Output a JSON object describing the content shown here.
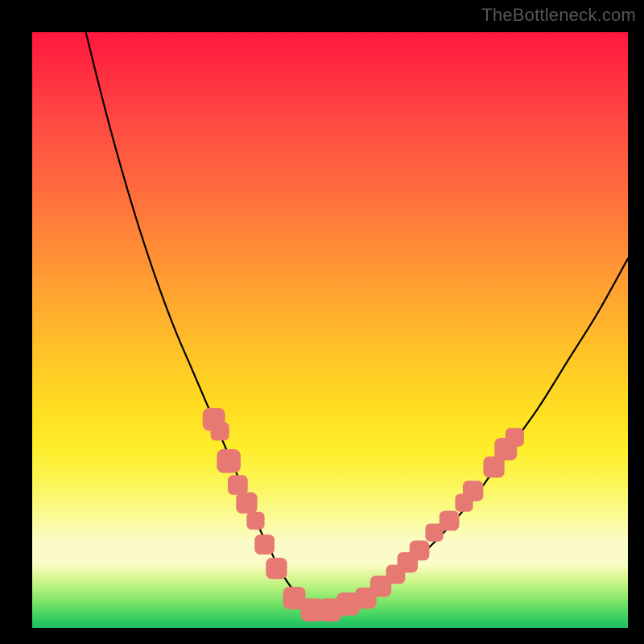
{
  "watermark": "TheBottleneck.com",
  "colors": {
    "frame": "#000000",
    "curve": "#000000",
    "markers": "#e77973"
  },
  "chart_data": {
    "type": "line",
    "title": "",
    "xlabel": "",
    "ylabel": "",
    "xlim": [
      0,
      100
    ],
    "ylim": [
      0,
      100
    ],
    "grid": false,
    "legend": false,
    "note": "V-shaped bottleneck curve over a vertical spectrum gradient (red = high bottleneck, green = none). x and y are read as 0–100% of the plot area; y=0 is the bottom.",
    "series": [
      {
        "name": "bottleneck-curve",
        "x": [
          9,
          12,
          15,
          18,
          21,
          24,
          27,
          30,
          33,
          36,
          38,
          40,
          42,
          45,
          48,
          52,
          56,
          60,
          65,
          70,
          75,
          80,
          85,
          90,
          95,
          100
        ],
        "y": [
          100,
          88,
          77,
          67,
          58,
          50,
          43,
          36,
          29,
          22,
          17,
          13,
          9,
          5,
          3,
          3,
          5,
          8,
          12,
          17,
          23,
          30,
          37,
          45,
          53,
          62
        ]
      }
    ],
    "markers": {
      "name": "highlighted-points",
      "shape": "rounded-rect",
      "points": [
        {
          "x": 30.5,
          "y": 35,
          "size": 2.2
        },
        {
          "x": 31.5,
          "y": 33,
          "size": 1.6
        },
        {
          "x": 33.0,
          "y": 28,
          "size": 2.4
        },
        {
          "x": 34.5,
          "y": 24,
          "size": 1.8
        },
        {
          "x": 36.0,
          "y": 21,
          "size": 2.0
        },
        {
          "x": 37.5,
          "y": 18,
          "size": 1.5
        },
        {
          "x": 39.0,
          "y": 14,
          "size": 1.8
        },
        {
          "x": 41.0,
          "y": 10,
          "size": 2.0
        },
        {
          "x": 44.0,
          "y": 5,
          "size": 2.2
        },
        {
          "x": 47.0,
          "y": 3,
          "size": 2.3
        },
        {
          "x": 50.0,
          "y": 3,
          "size": 2.3
        },
        {
          "x": 53.0,
          "y": 4,
          "size": 2.3
        },
        {
          "x": 56.0,
          "y": 5,
          "size": 2.0
        },
        {
          "x": 58.5,
          "y": 7,
          "size": 2.0
        },
        {
          "x": 61.0,
          "y": 9,
          "size": 1.7
        },
        {
          "x": 63.0,
          "y": 11,
          "size": 1.9
        },
        {
          "x": 65.0,
          "y": 13,
          "size": 1.8
        },
        {
          "x": 67.5,
          "y": 16,
          "size": 1.5
        },
        {
          "x": 70.0,
          "y": 18,
          "size": 1.8
        },
        {
          "x": 72.5,
          "y": 21,
          "size": 1.5
        },
        {
          "x": 74.0,
          "y": 23,
          "size": 1.9
        },
        {
          "x": 77.5,
          "y": 27,
          "size": 2.0
        },
        {
          "x": 79.5,
          "y": 30,
          "size": 2.2
        },
        {
          "x": 81.0,
          "y": 32,
          "size": 1.6
        }
      ]
    }
  }
}
